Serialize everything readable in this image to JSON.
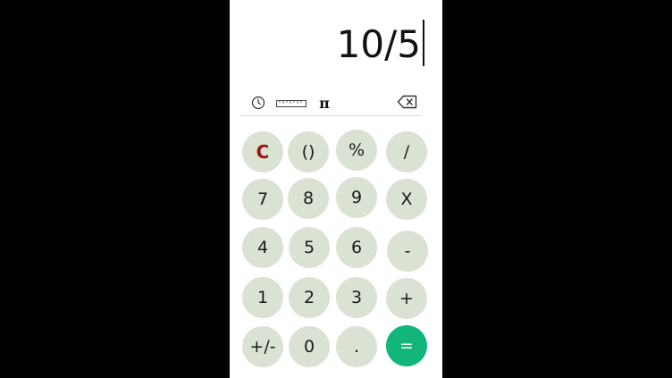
{
  "display": {
    "expression": "10/5"
  },
  "toolbar": {
    "history_icon": "clock-icon",
    "ruler_icon": "ruler-icon",
    "pi_label": "π",
    "backspace_icon": "backspace-icon"
  },
  "keypad": {
    "rows": [
      [
        "C",
        "()",
        "%",
        "/"
      ],
      [
        "7",
        "8",
        "9",
        "X"
      ],
      [
        "4",
        "5",
        "6",
        "-"
      ],
      [
        "1",
        "2",
        "3",
        "+"
      ],
      [
        "+/-",
        "0",
        ".",
        "="
      ]
    ]
  },
  "colors": {
    "key_background": "#d9e2d3",
    "clear_text": "#a01313",
    "equals_background": "#12b57a",
    "outer_background": "#000000",
    "screen_background": "#ffffff"
  }
}
